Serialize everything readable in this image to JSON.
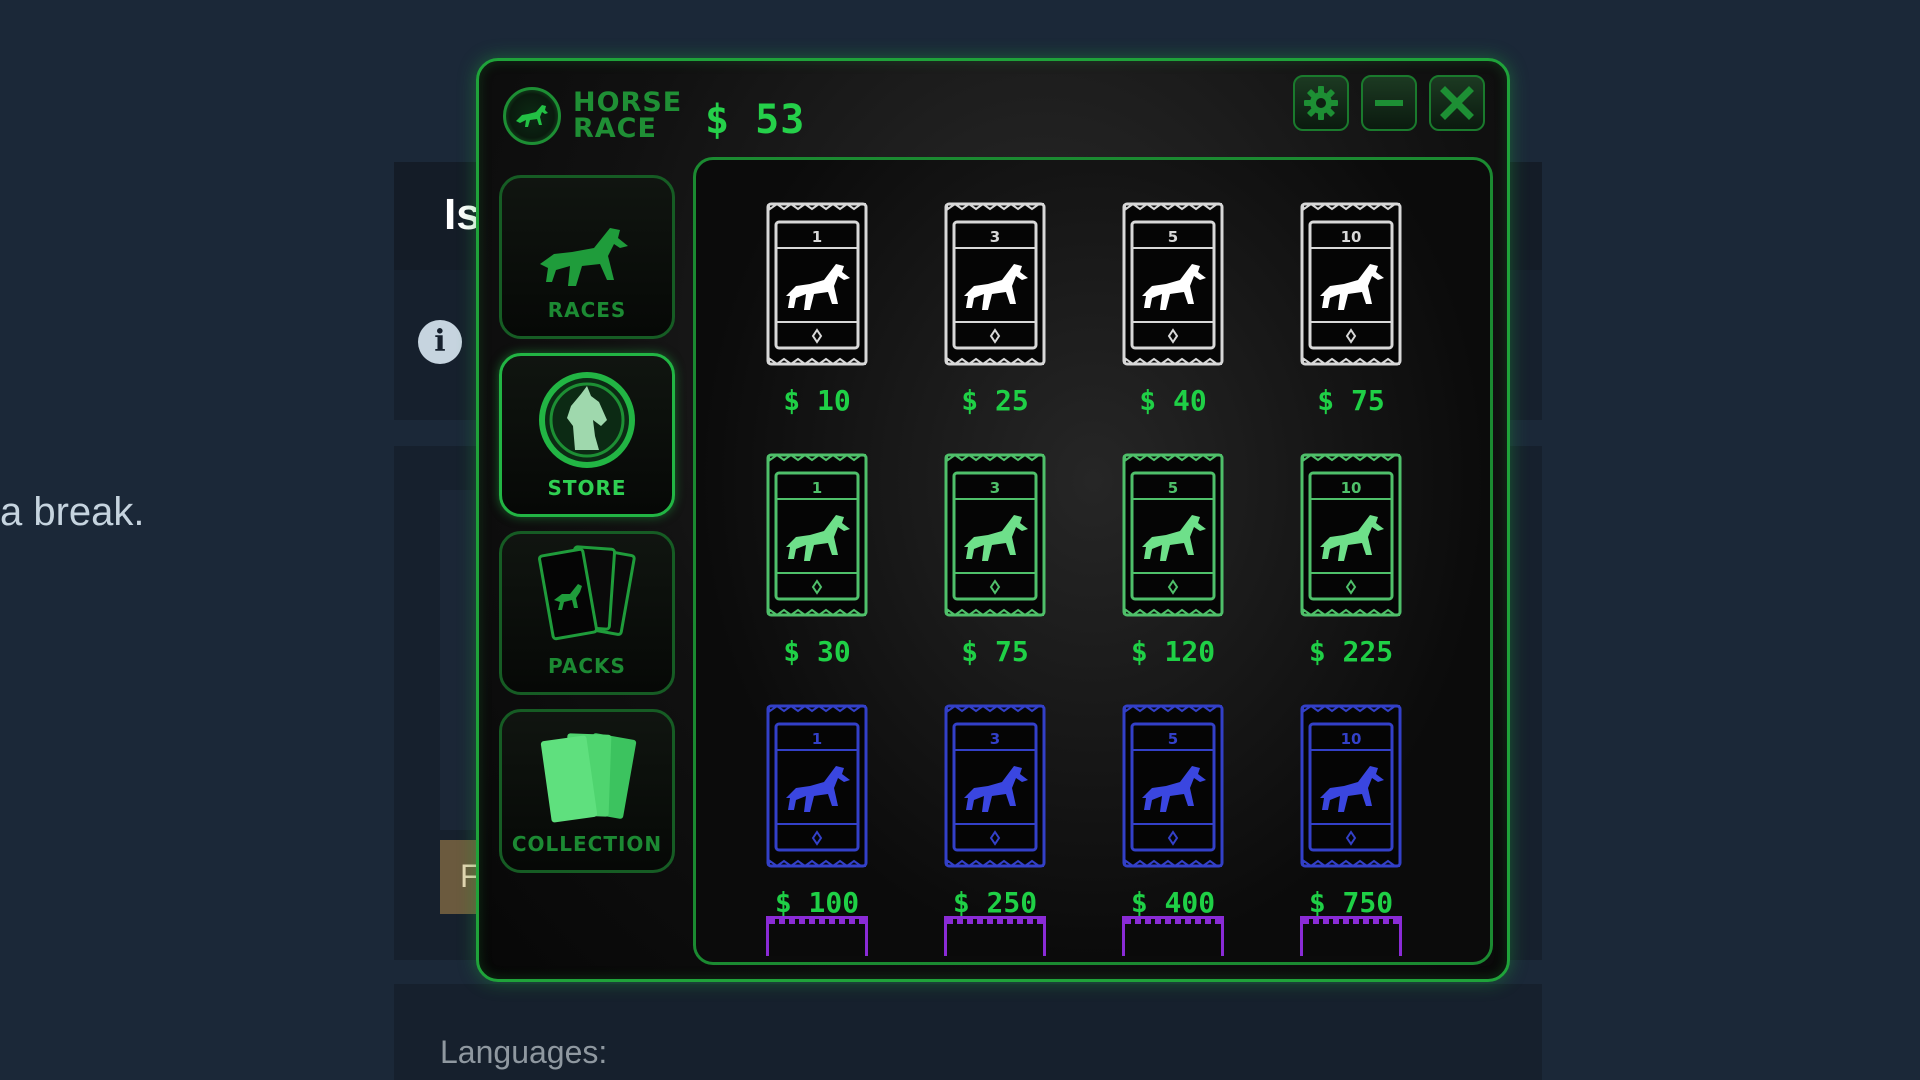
{
  "background": {
    "title_partial": "Is",
    "break_text": "a break.",
    "button_partial": "F",
    "languages_label": "Languages:"
  },
  "app": {
    "brand_line1": "HORSE",
    "brand_line2": "RACE",
    "balance": "$ 53",
    "accent_color": "#1fd046",
    "window_buttons": {
      "settings_icon": "gear-icon",
      "minimize_icon": "minimize-icon",
      "close_icon": "close-icon"
    }
  },
  "sidebar": {
    "items": [
      {
        "label": "RACES",
        "icon": "horse-icon",
        "active": false
      },
      {
        "label": "STORE",
        "icon": "horse-head-icon",
        "active": true
      },
      {
        "label": "PACKS",
        "icon": "packs-icon",
        "active": false
      },
      {
        "label": "COLLECTION",
        "icon": "cards-icon",
        "active": false
      }
    ]
  },
  "store": {
    "rows": [
      {
        "tier": "white",
        "color": "#d8d8d8",
        "horse_color": "#ffffff",
        "packs": [
          {
            "count": "1",
            "price": "$ 10"
          },
          {
            "count": "3",
            "price": "$ 25"
          },
          {
            "count": "5",
            "price": "$ 40"
          },
          {
            "count": "10",
            "price": "$ 75"
          }
        ]
      },
      {
        "tier": "green",
        "color": "#4fc06a",
        "horse_color": "#6ee08a",
        "packs": [
          {
            "count": "1",
            "price": "$ 30"
          },
          {
            "count": "3",
            "price": "$ 75"
          },
          {
            "count": "5",
            "price": "$ 120"
          },
          {
            "count": "10",
            "price": "$ 225"
          }
        ]
      },
      {
        "tier": "blue",
        "color": "#3340c8",
        "horse_color": "#3a46e0",
        "packs": [
          {
            "count": "1",
            "price": "$ 100"
          },
          {
            "count": "3",
            "price": "$ 250"
          },
          {
            "count": "5",
            "price": "$ 400"
          },
          {
            "count": "10",
            "price": "$ 750"
          }
        ]
      }
    ],
    "next_row_tier": "purple",
    "next_row_color": "#8a2bd6"
  }
}
